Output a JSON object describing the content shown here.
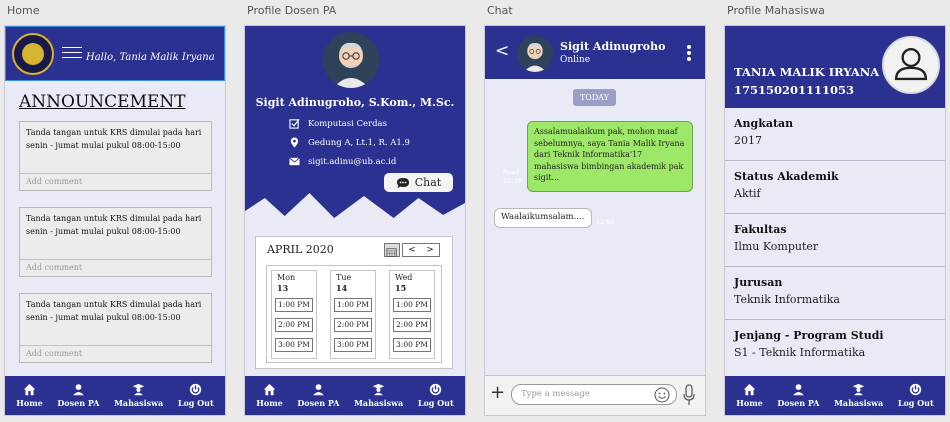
{
  "frames": {
    "home": "Home",
    "dosen": "Profile Dosen PA",
    "chat": "Chat",
    "mhs": "Profile Mahasiswa"
  },
  "nav": {
    "home": "Home",
    "dosen": "Dosen PA",
    "mahasiswa": "Mahasiswa",
    "logout": "Log Out"
  },
  "home": {
    "greeting": "Hallo, Tania Malik Iryana",
    "title": "ANNOUNCEMENT",
    "cards": [
      {
        "text": "Tanda tangan untuk KRS dimulai pada hari senin - jumat mulai pukul 08:00-15:00",
        "comment_placeholder": "Add comment"
      },
      {
        "text": "Tanda tangan untuk KRS dimulai pada hari senin - jumat mulai pukul 08:00-15:00",
        "comment_placeholder": "Add comment"
      },
      {
        "text": "Tanda tangan untuk KRS dimulai pada hari senin - jumat mulai pukul 08:00-15:00",
        "comment_placeholder": "Add comment"
      }
    ]
  },
  "dosen": {
    "name": "Sigit Adinugroho, S.Kom., M.Sc.",
    "lab": "Komputasi Cerdas",
    "room": "Gedung A, Lt.1, R. A1.9",
    "email": "sigit.adinu@ub.ac.id",
    "chat_label": "Chat",
    "calendar": {
      "month": "APRIL 2020",
      "prev": "<",
      "next": ">",
      "days": [
        {
          "name": "Mon",
          "num": "13",
          "slots": [
            "1:00 PM",
            "2:00 PM",
            "3:00 PM"
          ]
        },
        {
          "name": "Tue",
          "num": "14",
          "slots": [
            "1:00 PM",
            "2:00 PM",
            "3:00 PM"
          ]
        },
        {
          "name": "Wed",
          "num": "15",
          "slots": [
            "1:00 PM",
            "2:00 PM",
            "3:00 PM"
          ]
        }
      ]
    }
  },
  "chat": {
    "name": "Sigit Adinugroho",
    "status": "Online",
    "today": "TODAY",
    "out_msg": "Assalamualaikum pak, mohon maaf sebelumnya, saya Tania Malik Iryana dari Teknik Informatika'17 mahasiswa bimbingan akademik pak sigit...",
    "out_meta_1": "Read",
    "out_meta_2": "12:30",
    "in_msg": "Waalaikumsalam....",
    "in_time": "12:50",
    "placeholder": "Type a message"
  },
  "mhs": {
    "name": "TANIA MALIK IRYANA",
    "nim": "175150201111053",
    "fields": [
      {
        "label": "Angkatan",
        "value": "2017"
      },
      {
        "label": "Status Akademik",
        "value": "Aktif"
      },
      {
        "label": "Fakultas",
        "value": "Ilmu Komputer"
      },
      {
        "label": "Jurusan",
        "value": "Teknik Informatika"
      },
      {
        "label": "Jenjang - Program Studi",
        "value": "S1 - Teknik Informatika"
      }
    ]
  },
  "colors": {
    "primary": "#2b3190",
    "bubble_out": "#9de868",
    "background": "#e9eaf6"
  }
}
